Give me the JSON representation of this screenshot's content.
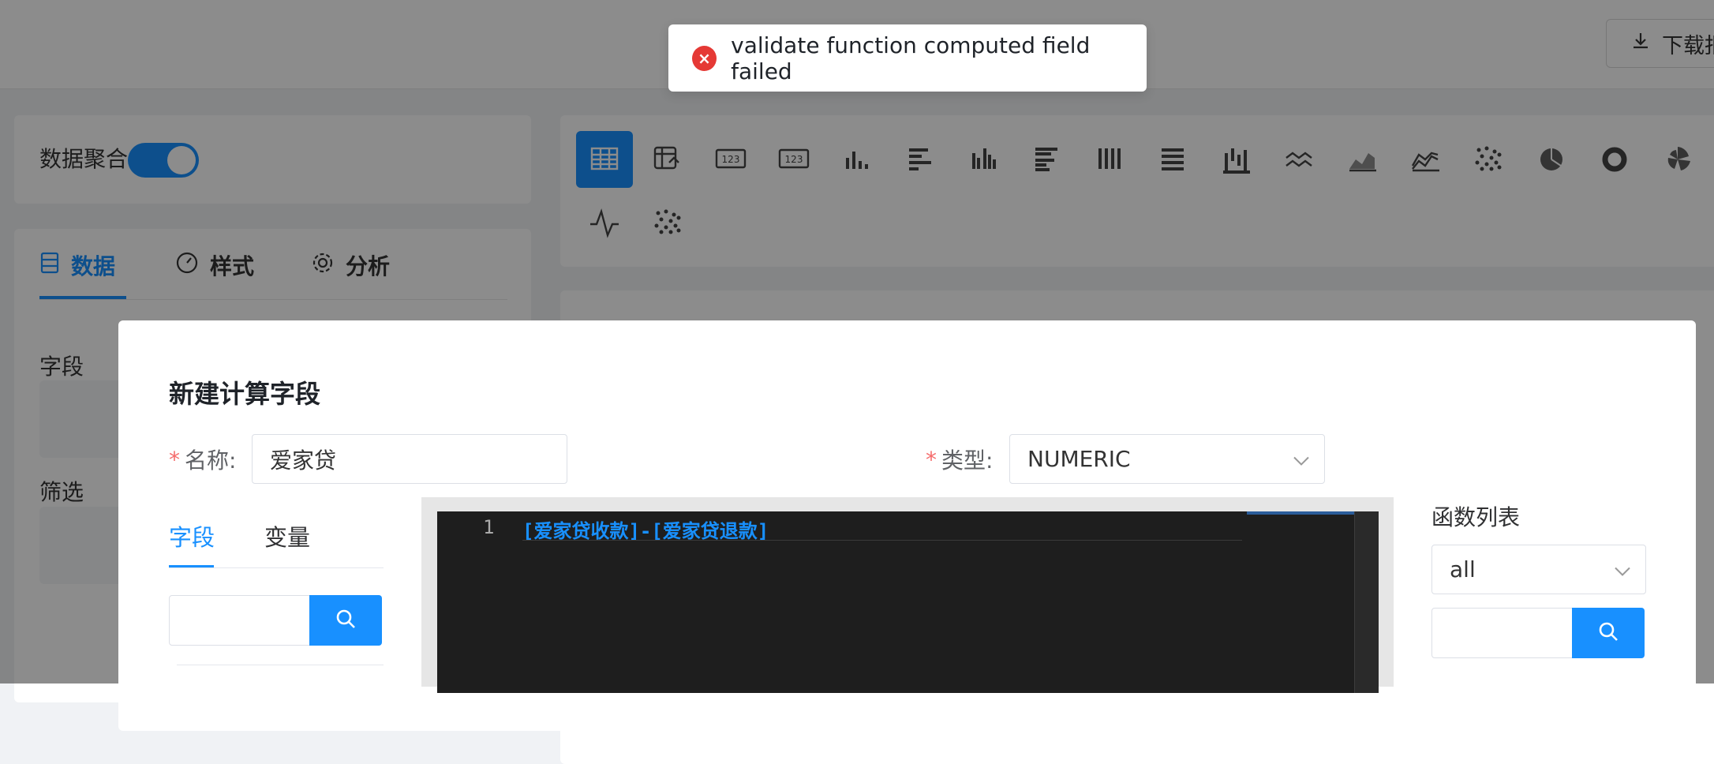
{
  "header": {
    "download_label": "下载报告"
  },
  "aggregation": {
    "label": "数据聚合",
    "enabled": true
  },
  "left_tabs": [
    {
      "label": "数据",
      "icon": "database-icon",
      "active": true
    },
    {
      "label": "样式",
      "icon": "gauge-icon",
      "active": false
    },
    {
      "label": "分析",
      "icon": "gear-icon",
      "active": false
    }
  ],
  "left_sections": {
    "fields_label": "字段",
    "filter_label": "筛选"
  },
  "chart_types": [
    "table-icon",
    "pivot-table-icon",
    "number-card-icon",
    "number-card-alt-icon",
    "bar-chart-icon",
    "horizontal-bar-icon",
    "grouped-bar-icon",
    "grouped-horizontal-bar-icon",
    "stacked-bar-icon",
    "stacked-horizontal-bar-icon",
    "waterfall-icon",
    "line-icon",
    "area-icon",
    "stacked-area-icon",
    "scatter-icon",
    "pie-icon",
    "donut-icon",
    "rose-icon",
    "sparkline-icon",
    "bubble-icon"
  ],
  "dialog": {
    "title": "新建计算字段",
    "name_label": "名称:",
    "name_value": "爱家贷",
    "type_label": "类型:",
    "type_value": "NUMERIC",
    "tabs": [
      {
        "label": "字段",
        "active": true
      },
      {
        "label": "变量",
        "active": false
      }
    ],
    "editor": {
      "line_number": "1",
      "code": "[爱家贷收款]-[爱家贷退款]"
    },
    "functions_label": "函数列表",
    "functions_filter": "all"
  },
  "toast": {
    "message": "validate function computed field failed",
    "type": "error"
  },
  "colors": {
    "primary": "#1890ff",
    "error": "#e53935"
  }
}
